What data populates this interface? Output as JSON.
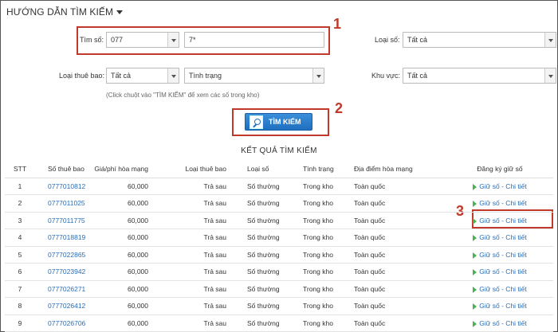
{
  "guide_title": "HƯỚNG DẪN TÌM KIẾM",
  "form": {
    "number_label": "Tìm số:",
    "prefix_value": "077",
    "pattern_value": "7*",
    "number_type_label": "Loại số:",
    "number_type_value": "Tất cả",
    "subscriber_type_label": "Loại thuê bao:",
    "subscriber_type_value": "Tất cả",
    "status_value": "Tình trạng",
    "region_label": "Khu vực:",
    "region_value": "Tất cả",
    "hint": "(Click chuột vào \"TÌM KIẾM\" để xem các số trong kho)",
    "search_button": "TÌM KIẾM"
  },
  "steps": [
    "1",
    "2",
    "3"
  ],
  "results": {
    "title": "KẾT QUẢ TÌM KIẾM",
    "columns": [
      "STT",
      "Số thuê bao",
      "Giá/phí hòa mạng",
      "Loại thuê bao",
      "Loại số",
      "Tình trạng",
      "Địa điểm hòa mạng",
      "Đăng ký giữ số"
    ],
    "rows": [
      [
        "1",
        "0777010812",
        "60,000",
        "Trả sau",
        "Số thường",
        "Trong kho",
        "Toàn quốc",
        "Giữ số - Chi tiết"
      ],
      [
        "2",
        "0777011025",
        "60,000",
        "Trả sau",
        "Số thường",
        "Trong kho",
        "Toàn quốc",
        "Giữ số - Chi tiết"
      ],
      [
        "3",
        "0777011775",
        "60,000",
        "Trả sau",
        "Số thường",
        "Trong kho",
        "Toàn quốc",
        "Giữ số - Chi tiết"
      ],
      [
        "4",
        "0777018819",
        "60,000",
        "Trả sau",
        "Số thường",
        "Trong kho",
        "Toàn quốc",
        "Giữ số - Chi tiết"
      ],
      [
        "5",
        "0777022865",
        "60,000",
        "Trả sau",
        "Số thường",
        "Trong kho",
        "Toàn quốc",
        "Giữ số - Chi tiết"
      ],
      [
        "6",
        "0777023942",
        "60,000",
        "Trả sau",
        "Số thường",
        "Trong kho",
        "Toàn quốc",
        "Giữ số - Chi tiết"
      ],
      [
        "7",
        "0777026271",
        "60,000",
        "Trả sau",
        "Số thường",
        "Trong kho",
        "Toàn quốc",
        "Giữ số - Chi tiết"
      ],
      [
        "8",
        "0777026412",
        "60,000",
        "Trả sau",
        "Số thường",
        "Trong kho",
        "Toàn quốc",
        "Giữ số - Chi tiết"
      ],
      [
        "9",
        "0777026706",
        "60,000",
        "Trả sau",
        "Số thường",
        "Trong kho",
        "Toàn quốc",
        "Giữ số - Chi tiết"
      ]
    ]
  },
  "colors": {
    "annotation_red": "#c0392b",
    "link_blue": "#2a6db5",
    "button_blue": "#1f6fbf"
  }
}
